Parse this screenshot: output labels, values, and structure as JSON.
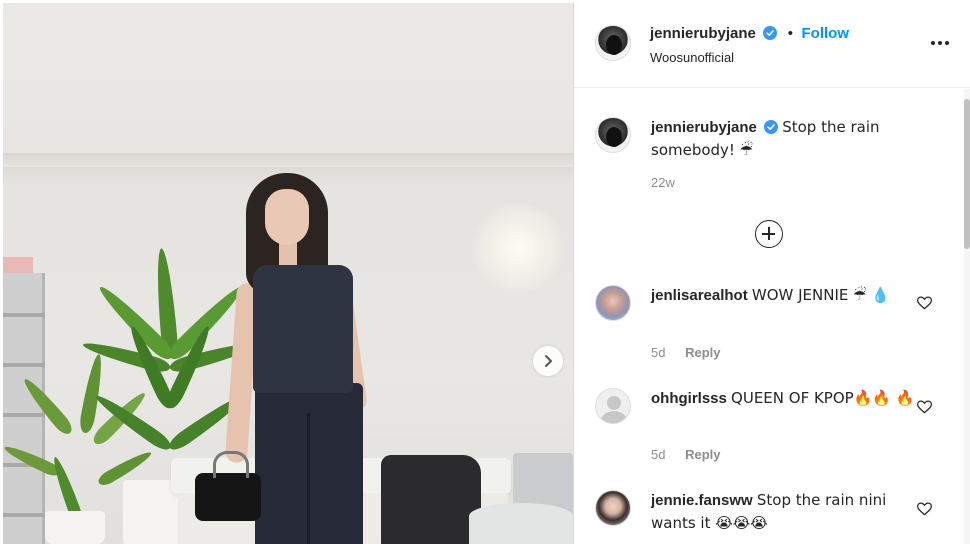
{
  "post": {
    "author": "jennierubyjane",
    "follow_label": "Follow",
    "dot": "•",
    "subtitle": "Woosunofficial",
    "caption_text": "Stop the rain somebody! ☔",
    "caption_time": "22w"
  },
  "comments": [
    {
      "username": "jenlisarealhot",
      "text": "WOW JENNIE ☔ 💧",
      "time": "5d",
      "reply_label": "Reply"
    },
    {
      "username": "ohhgirlsss",
      "text": "QUEEN OF KPOP🔥🔥 🔥",
      "time": "5d",
      "reply_label": "Reply"
    },
    {
      "username": "jennie.fansww",
      "text": "Stop the rain nini wants it 😭😭😭",
      "time": "",
      "reply_label": ""
    }
  ],
  "icons": {
    "verified": "verified-badge-icon",
    "more": "more-options-icon",
    "next": "chevron-right-icon",
    "plus": "load-more-plus-icon",
    "heart": "heart-icon"
  },
  "colors": {
    "link": "#0095f6",
    "verified": "#3897f0",
    "muted": "#8e8e8e",
    "text": "#262626"
  }
}
